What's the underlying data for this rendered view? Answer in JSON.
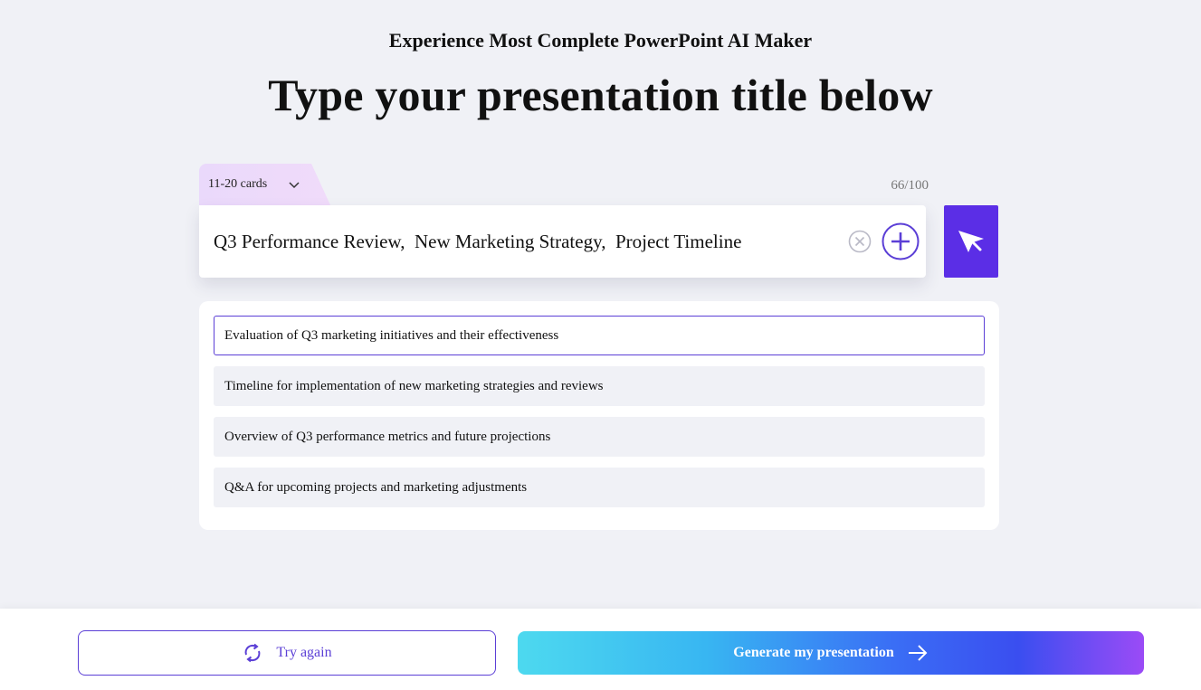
{
  "header": {
    "subtitle": "Experience Most Complete PowerPoint AI Maker",
    "title": "Type your presentation title below"
  },
  "cards_selector": {
    "label": "11-20 cards"
  },
  "counter": "66/100",
  "title_input": {
    "value": "Q3 Performance Review,  New Marketing Strategy,  Project Timeline"
  },
  "outline": {
    "items": [
      "Evaluation of Q3 marketing initiatives and their effectiveness",
      "Timeline for implementation of new marketing strategies and reviews",
      "Overview of Q3 performance metrics and future projections",
      "Q&A  for upcoming projects and marketing adjustments"
    ]
  },
  "footer": {
    "try_again": "Try again",
    "generate": "Generate my presentation"
  },
  "colors": {
    "accent": "#5b2ee6",
    "background": "#f0f1f6"
  }
}
